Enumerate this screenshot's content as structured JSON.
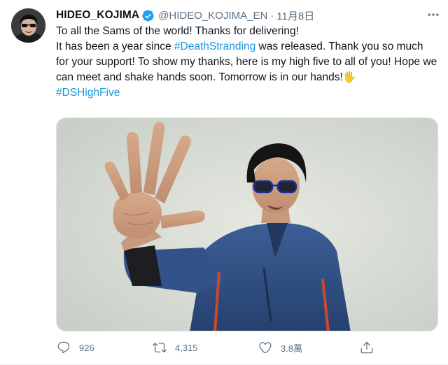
{
  "tweet": {
    "author": {
      "display_name": "HIDEO_KOJIMA",
      "handle": "@HIDEO_KOJIMA_EN",
      "verified": true,
      "avatar_icon": "user-avatar"
    },
    "separator": "·",
    "date": "11月8日",
    "more_icon": "more-horizontal-icon",
    "text": {
      "line1": "To all the Sams of the world! Thanks for delivering!",
      "para2_before": "It has been a year since ",
      "hashtag1": "#DeathStranding",
      "para2_after": " was released. Thank you so much for your support! To show my thanks, here is my high five to all of you! Hope we can meet and shake hands soon. Tomorrow is in our hands!",
      "emoji": "🖐",
      "hashtag2": "#DSHighFive"
    },
    "media": {
      "kind": "photo",
      "subject": "raised-hand-portrait"
    },
    "actions": {
      "reply_count": "926",
      "retweet_count": "4,315",
      "like_count": "3.8萬",
      "share_count": ""
    }
  },
  "colors": {
    "link": "#1b95e0",
    "secondary_text": "#5b7083",
    "verified": "#1da1f2",
    "text": "#0f1419"
  }
}
